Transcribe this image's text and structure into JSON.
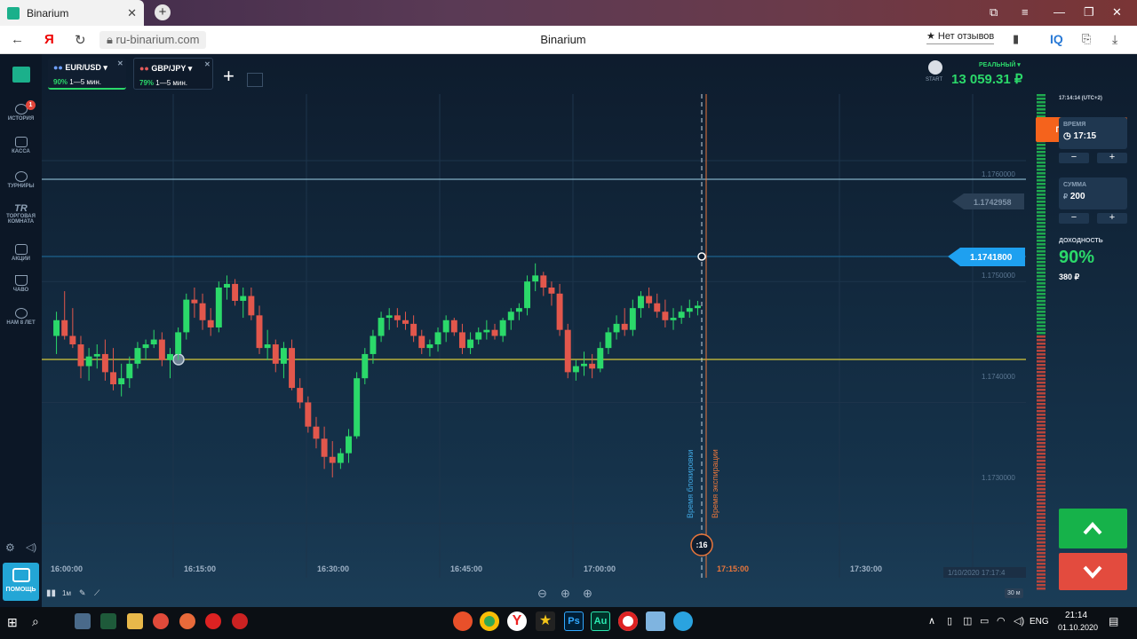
{
  "browser": {
    "tab_title": "Binarium",
    "url": "ru-binarium.com",
    "page_title": "Binarium",
    "reviews_label": "★ Нет отзывов",
    "iq_label": "IQ"
  },
  "assets": [
    {
      "name": "EUR/USD ▾",
      "pct": "90%",
      "term": "1—5 мин."
    },
    {
      "name": "GBP/JPY ▾",
      "pct": "79%",
      "term": "1—5 мин."
    }
  ],
  "sidebar": {
    "items": [
      "ИСТОРИЯ",
      "КАССА",
      "ТУРНИРЫ",
      "ТОРГОВАЯ КОМНАТА",
      "АКЦИИ",
      "ЧАВО",
      "НАМ 8 ЛЕТ"
    ],
    "history_badge": "1",
    "help_label": "ПОМОЩЬ",
    "tr_label": "TR"
  },
  "account": {
    "start_label": "START",
    "account_type": "РЕАЛЬНЫЙ ▾",
    "balance": "13 059.31 ₽",
    "deposit_label": "ПОПОЛНИТЬ"
  },
  "panel": {
    "clock": "17:14:14 (UTC+2)",
    "time_label": "ВРЕМЯ",
    "time_value": "17:15",
    "sum_label": "СУММА",
    "sum_currency": "₽",
    "sum_value": "200",
    "yield_label": "ДОХОДНОСТЬ",
    "yield_pct": "90%",
    "yield_amount": "380 ₽",
    "minus": "−",
    "plus": "+"
  },
  "chart": {
    "current_price": "1.1741800",
    "hover_price": "1.1742958",
    "y_ticks": [
      "1.1760000",
      "1.1750000",
      "1.1740000",
      "1.1730000"
    ],
    "x_ticks": [
      "16:00:00",
      "16:15:00",
      "16:30:00",
      "16:45:00",
      "17:00:00",
      "17:15:00",
      "17:30:00"
    ],
    "block_label": "Время блокировки",
    "expiry_label": "Время экспирации",
    "countdown": ":16",
    "date_label": "1/10/2020 17:17:4",
    "timeframe": "1м",
    "zoom_label": "30 м"
  },
  "taskbar": {
    "lang": "ENG",
    "time": "21:14",
    "date": "01.10.2020"
  },
  "chart_data": {
    "type": "candlestick",
    "candles": [
      [
        1.17455,
        1.17475,
        1.1744,
        1.17468
      ],
      [
        1.17468,
        1.17492,
        1.17452,
        1.17455
      ],
      [
        1.17455,
        1.17478,
        1.17445,
        1.17448
      ],
      [
        1.17448,
        1.17455,
        1.1742,
        1.1743
      ],
      [
        1.1743,
        1.17445,
        1.17418,
        1.17438
      ],
      [
        1.17438,
        1.17448,
        1.17428,
        1.1744
      ],
      [
        1.1744,
        1.17452,
        1.17418,
        1.17425
      ],
      [
        1.17425,
        1.17445,
        1.1741,
        1.17415
      ],
      [
        1.17415,
        1.17432,
        1.17405,
        1.1742
      ],
      [
        1.1742,
        1.17438,
        1.17412,
        1.17432
      ],
      [
        1.17432,
        1.1745,
        1.17428,
        1.17445
      ],
      [
        1.17445,
        1.17452,
        1.17435,
        1.17448
      ],
      [
        1.17448,
        1.1746,
        1.17445,
        1.17452
      ],
      [
        1.17452,
        1.17458,
        1.1743,
        1.17435
      ],
      [
        1.17435,
        1.17445,
        1.1742,
        1.1744
      ],
      [
        1.1744,
        1.17462,
        1.17435,
        1.17458
      ],
      [
        1.17458,
        1.1749,
        1.17452,
        1.17485
      ],
      [
        1.17485,
        1.17495,
        1.1747,
        1.17482
      ],
      [
        1.17482,
        1.1749,
        1.1746,
        1.17468
      ],
      [
        1.17468,
        1.17478,
        1.17455,
        1.17462
      ],
      [
        1.17462,
        1.175,
        1.17458,
        1.17495
      ],
      [
        1.17495,
        1.17505,
        1.17485,
        1.17498
      ],
      [
        1.17498,
        1.17502,
        1.1748,
        1.17484
      ],
      [
        1.17484,
        1.17495,
        1.1747,
        1.17488
      ],
      [
        1.17488,
        1.17495,
        1.17468,
        1.17472
      ],
      [
        1.17472,
        1.1748,
        1.1744,
        1.17445
      ],
      [
        1.17445,
        1.1746,
        1.17435,
        1.17448
      ],
      [
        1.17448,
        1.17452,
        1.17425,
        1.17432
      ],
      [
        1.17432,
        1.1745,
        1.1742,
        1.17445
      ],
      [
        1.17445,
        1.17452,
        1.1741,
        1.17412
      ],
      [
        1.17412,
        1.1742,
        1.17395,
        1.174
      ],
      [
        1.174,
        1.17405,
        1.17375,
        1.1738
      ],
      [
        1.1738,
        1.17388,
        1.17362,
        1.1737
      ],
      [
        1.1737,
        1.1738,
        1.17345,
        1.17355
      ],
      [
        1.17355,
        1.17368,
        1.17338,
        1.1735
      ],
      [
        1.1735,
        1.17362,
        1.17345,
        1.17358
      ],
      [
        1.17358,
        1.17378,
        1.1735,
        1.17372
      ],
      [
        1.17372,
        1.17425,
        1.1737,
        1.1742
      ],
      [
        1.1742,
        1.17445,
        1.17415,
        1.1744
      ],
      [
        1.1744,
        1.1746,
        1.17432,
        1.17455
      ],
      [
        1.17455,
        1.17475,
        1.1745,
        1.1747
      ],
      [
        1.1747,
        1.17478,
        1.1746,
        1.17472
      ],
      [
        1.17472,
        1.17478,
        1.17462,
        1.17468
      ],
      [
        1.17468,
        1.17475,
        1.1746,
        1.17465
      ],
      [
        1.17465,
        1.17472,
        1.1745,
        1.17455
      ],
      [
        1.17455,
        1.1746,
        1.1744,
        1.17445
      ],
      [
        1.17445,
        1.17452,
        1.17438,
        1.17448
      ],
      [
        1.17448,
        1.17462,
        1.17442,
        1.17458
      ],
      [
        1.17458,
        1.17472,
        1.1745,
        1.17468
      ],
      [
        1.17468,
        1.1747,
        1.17455,
        1.17458
      ],
      [
        1.17458,
        1.17465,
        1.1744,
        1.17445
      ],
      [
        1.17445,
        1.17458,
        1.1744,
        1.17452
      ],
      [
        1.17452,
        1.17462,
        1.17448,
        1.17458
      ],
      [
        1.17458,
        1.17468,
        1.17452,
        1.1746
      ],
      [
        1.1746,
        1.17465,
        1.17452,
        1.17455
      ],
      [
        1.17455,
        1.1747,
        1.1745,
        1.17468
      ],
      [
        1.17468,
        1.17478,
        1.1746,
        1.17475
      ],
      [
        1.17475,
        1.17482,
        1.17468,
        1.17478
      ],
      [
        1.17478,
        1.17505,
        1.17472,
        1.175
      ],
      [
        1.175,
        1.17515,
        1.17492,
        1.17505
      ],
      [
        1.17505,
        1.17508,
        1.17488,
        1.17495
      ],
      [
        1.17495,
        1.175,
        1.1748,
        1.1749
      ],
      [
        1.1749,
        1.17498,
        1.17455,
        1.1746
      ],
      [
        1.1746,
        1.17465,
        1.1742,
        1.17425
      ],
      [
        1.17425,
        1.17435,
        1.17418,
        1.1743
      ],
      [
        1.1743,
        1.17442,
        1.17422,
        1.17432
      ],
      [
        1.17432,
        1.1744,
        1.1742,
        1.17428
      ],
      [
        1.17428,
        1.1745,
        1.17425,
        1.17445
      ],
      [
        1.17445,
        1.17462,
        1.1744,
        1.17458
      ],
      [
        1.17458,
        1.17472,
        1.17452,
        1.17465
      ],
      [
        1.17465,
        1.17478,
        1.17455,
        1.1746
      ],
      [
        1.1746,
        1.17485,
        1.17455,
        1.17478
      ],
      [
        1.17478,
        1.17492,
        1.1747,
        1.17488
      ],
      [
        1.17488,
        1.17495,
        1.17478,
        1.17482
      ],
      [
        1.17482,
        1.1749,
        1.1747,
        1.17475
      ],
      [
        1.17475,
        1.17485,
        1.17462,
        1.17468
      ],
      [
        1.17468,
        1.17478,
        1.1746,
        1.1747
      ],
      [
        1.1747,
        1.1748,
        1.17465,
        1.17475
      ],
      [
        1.17475,
        1.17485,
        1.1747,
        1.17478
      ],
      [
        1.17478,
        1.17484,
        1.17472,
        1.1748
      ]
    ],
    "levels": [
      1.17585,
      1.17418
    ],
    "current": 1.17418,
    "ylim": [
      1.17255,
      1.17655
    ],
    "y_ticks": [
      1.176,
      1.175,
      1.174,
      1.173
    ],
    "x_range": [
      "15:56",
      "17:36"
    ],
    "colors": {
      "up": "#2bd96a",
      "down": "#e2574c",
      "current": "#1ea0f0",
      "support": "#d6c93a"
    }
  }
}
